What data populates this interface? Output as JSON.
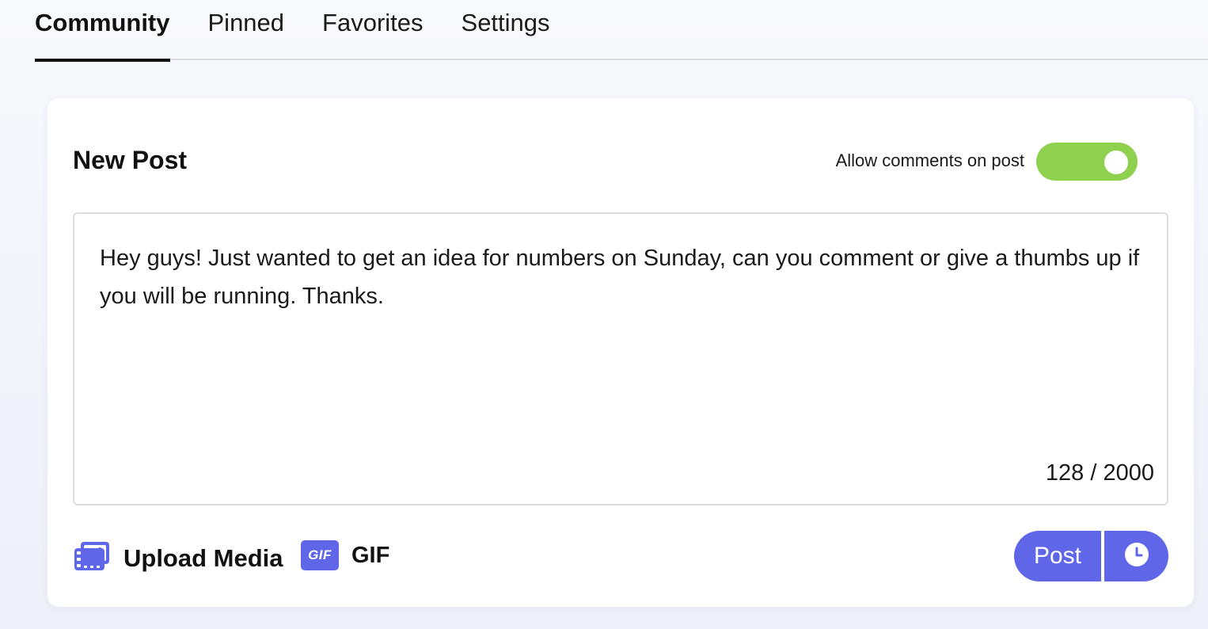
{
  "tabs": [
    {
      "label": "Community",
      "active": true
    },
    {
      "label": "Pinned",
      "active": false
    },
    {
      "label": "Favorites",
      "active": false
    },
    {
      "label": "Settings",
      "active": false
    }
  ],
  "composer": {
    "title": "New Post",
    "allow_comments_label": "Allow comments on post",
    "allow_comments_enabled": true,
    "text": "Hey guys! Just wanted to get an idea for numbers on Sunday, can you comment or give a thumbs up if you will be running. Thanks.",
    "counter": "128 / 2000",
    "upload_label": "Upload Media",
    "upload_icon": "image-upload-icon",
    "gif_badge": "GIF",
    "gif_label": "GIF",
    "post_label": "Post",
    "schedule_icon": "clock-icon"
  },
  "colors": {
    "accent": "#5f67e8",
    "toggle_on": "#8fd14f",
    "background": "#f4f5fb"
  }
}
